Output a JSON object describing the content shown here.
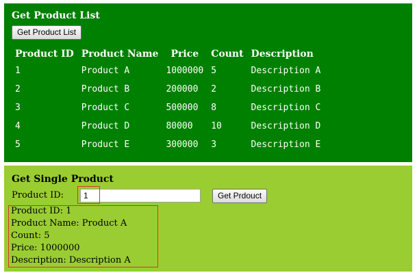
{
  "product_list": {
    "title": "Get Product List",
    "button_label": "Get Product List",
    "columns": [
      "Product ID",
      "Product Name",
      "Price",
      "Count",
      "Description"
    ],
    "rows": [
      [
        "1",
        "Product A",
        "1000000",
        "5",
        "Description A"
      ],
      [
        "2",
        "Product B",
        "200000",
        "2",
        "Description B"
      ],
      [
        "3",
        "Product C",
        "500000",
        "8",
        "Description C"
      ],
      [
        "4",
        "Product D",
        "80000",
        "10",
        "Description D"
      ],
      [
        "5",
        "Product E",
        "300000",
        "3",
        "Description E"
      ]
    ]
  },
  "single_product": {
    "title": "Get Single Product",
    "id_label": "Product ID:",
    "id_value": "1",
    "button_label": "Get Prdouct",
    "details": {
      "id_line": "Product ID: 1",
      "name_line": "Product Name: Product A",
      "count_line": "Count: 5",
      "price_line": "Price: 1000000",
      "description_line": "Description: Description A"
    }
  },
  "colors": {
    "list_panel": "#008000",
    "single_panel": "#9acd32",
    "highlight": "#e0302a"
  }
}
